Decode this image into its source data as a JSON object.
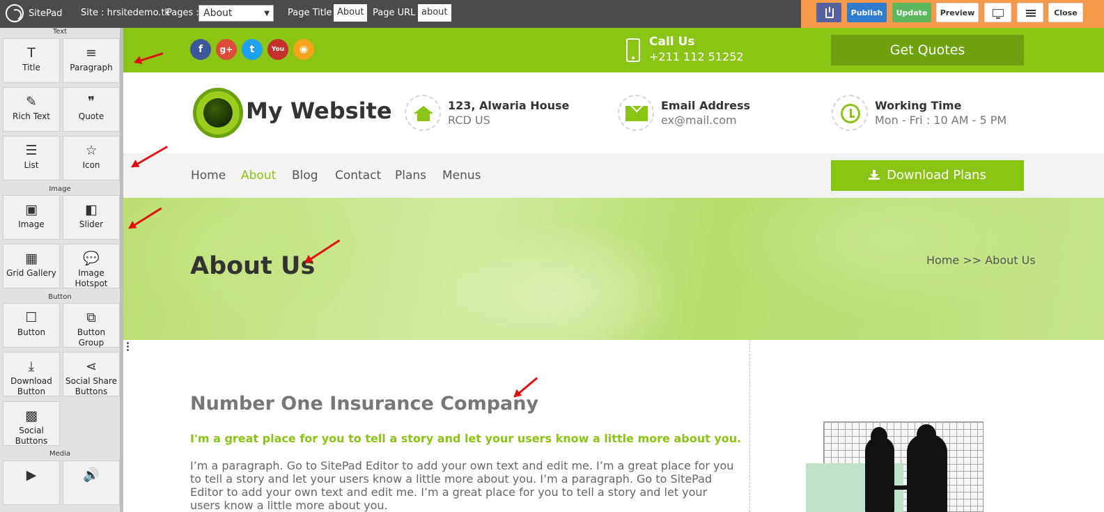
{
  "topbar": {
    "brand": "SitePad",
    "site_label": "Site : hrsitedemo.tk",
    "pages_label": "Pages :",
    "pages_selected": "About",
    "page_title_label": "Page Title :",
    "page_title_value": "About",
    "page_url_label": "Page URL :",
    "page_url_value": "about",
    "publish": "Publish",
    "update": "Update",
    "preview": "Preview",
    "close": "Close"
  },
  "sidebar": {
    "cat_text": "Text",
    "cat_image": "Image",
    "cat_button": "Button",
    "cat_media": "Media",
    "tiles": {
      "title": {
        "icon": "T",
        "label": "Title"
      },
      "paragraph": {
        "icon": "≡",
        "label": "Paragraph"
      },
      "richtext": {
        "icon": "✎",
        "label": "Rich Text"
      },
      "quote": {
        "icon": "❞",
        "label": "Quote"
      },
      "list": {
        "icon": "☰",
        "label": "List"
      },
      "icon": {
        "icon": "☆",
        "label": "Icon"
      },
      "image": {
        "icon": "▣",
        "label": "Image"
      },
      "slider": {
        "icon": "◧",
        "label": "Slider"
      },
      "grid": {
        "icon": "▦",
        "label": "Grid Gallery"
      },
      "hotspot": {
        "icon": "💬",
        "label": "Image Hotspot"
      },
      "button": {
        "icon": "☐",
        "label": "Button"
      },
      "buttongroup": {
        "icon": "⧉",
        "label": "Button Group"
      },
      "download": {
        "icon": "⤓",
        "label": "Download Button"
      },
      "share": {
        "icon": "⋖",
        "label": "Social Share Buttons"
      },
      "social": {
        "icon": "▩",
        "label": "Social Buttons"
      },
      "video": {
        "icon": "▶",
        "label": ""
      },
      "audio": {
        "icon": "🔊",
        "label": ""
      }
    }
  },
  "site": {
    "social": {
      "facebook": "f",
      "googleplus": "g+",
      "twitter": "t",
      "youtube": "You",
      "rss": "◉"
    },
    "call_title": "Call Us",
    "call_number": "+211 112 51252",
    "get_quotes": "Get Quotes",
    "logo_text": "My Website",
    "address_title": "123, Alwaria House",
    "address_sub": "RCD US",
    "email_title": "Email Address",
    "email_sub": "ex@mail.com",
    "time_title": "Working Time",
    "time_sub": "Mon - Fri : 10 AM - 5 PM",
    "nav": [
      "Home",
      "About",
      "Blog",
      "Contact",
      "Plans",
      "Menus"
    ],
    "download_plans": "Download Plans",
    "banner_title": "About Us",
    "breadcrumb": "Home >> About Us",
    "heading": "Number One Insurance Company",
    "subheading": "I'm a great place for you to tell a story and let your users know a little more about you.",
    "paragraph": "I’m a paragraph. Go to SitePad Editor to add your own text and edit me. I’m a great place for you to tell a story and let your users know a little more about you. I’m a paragraph. Go to SitePad Editor to add your own text and edit me. I’m a great place for you to tell a story and let your users know a little more about you."
  },
  "colors": {
    "brand_green": "#8ac414",
    "topbar": "#4b4b4b",
    "actions_bg": "#f59a4a",
    "annotation_red": "#e01010"
  }
}
